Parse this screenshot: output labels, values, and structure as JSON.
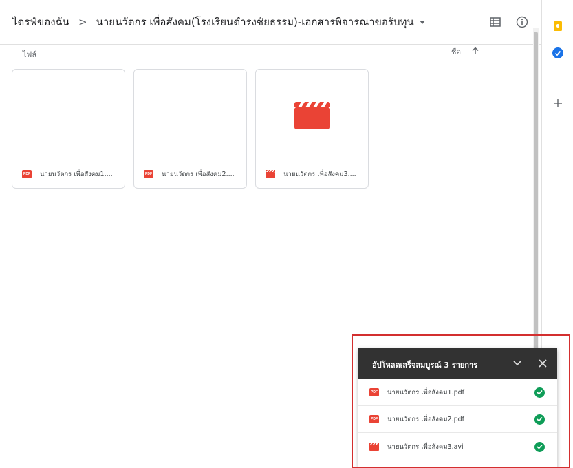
{
  "breadcrumb": {
    "root": "ไดรฟ์ของฉัน",
    "separator": ">",
    "current": "นายนวัตกร เพื่อสังคม(โรงเรียนดำรงชัยธรรม)-เอกสารพิจารณาขอรับทุน"
  },
  "toolbar": {
    "list_view_icon": "list-view-icon",
    "info_icon": "info-icon"
  },
  "files_section": {
    "title": "ไฟล์",
    "sort_label": "ชื่อ",
    "sort_icon": "arrow-up-icon"
  },
  "files": [
    {
      "name": "นายนวัตกร เพื่อสังคม1....",
      "type": "pdf"
    },
    {
      "name": "นายนวัตกร เพื่อสังคม2....",
      "type": "pdf"
    },
    {
      "name": "นายนวัตกร เพื่อสังคม3....",
      "type": "video"
    }
  ],
  "upload_panel": {
    "title": "อัปโหลดเสร็จสมบูรณ์ 3 รายการ",
    "items": [
      {
        "name": "นายนวัตกร เพื่อสังคม1.pdf",
        "type": "pdf",
        "status": "complete"
      },
      {
        "name": "นายนวัตกร เพื่อสังคม2.pdf",
        "type": "pdf",
        "status": "complete"
      },
      {
        "name": "นายนวัตกร เพื่อสังคม3.avi",
        "type": "video",
        "status": "complete"
      }
    ]
  },
  "side_panel": {
    "items": [
      "keep-icon",
      "tasks-icon",
      "add-icon"
    ]
  },
  "colors": {
    "pdf_red": "#ea4335",
    "video_red": "#ea4335",
    "success_green": "#0f9d58",
    "panel_header": "#323232",
    "highlight_border": "#d32f2f",
    "keep_yellow": "#fbbc04",
    "tasks_blue": "#1a73e8"
  },
  "pdf_badge_text": "PDF"
}
